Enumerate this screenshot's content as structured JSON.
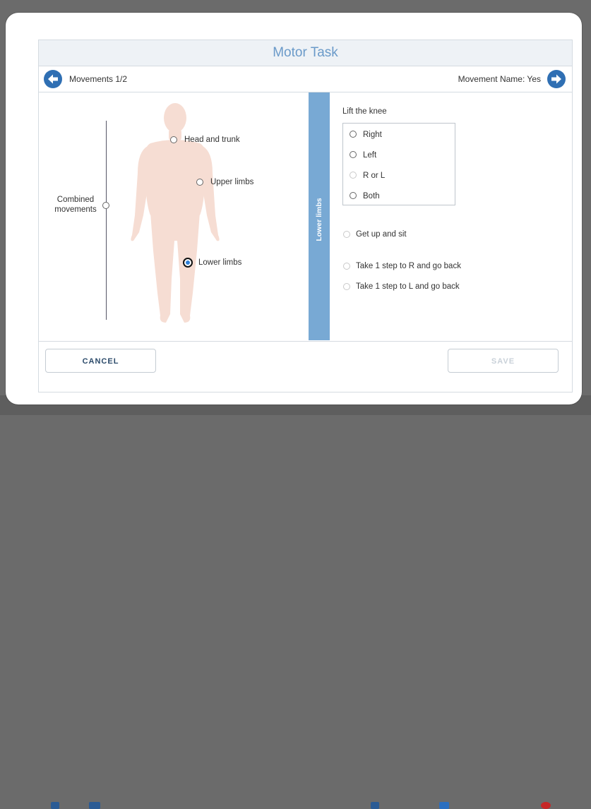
{
  "modal": {
    "title": "Motor Task"
  },
  "nav": {
    "left_label": "Movements 1/2",
    "right_label": "Movement Name: Yes",
    "back_icon": "arrow-left-icon",
    "forward_icon": "arrow-right-icon"
  },
  "body_map": {
    "combined_label": "Combined movements",
    "regions": [
      {
        "label": "Head and trunk",
        "selected": false
      },
      {
        "label": "Upper limbs",
        "selected": false
      },
      {
        "label": "Lower limbs",
        "selected": true
      }
    ]
  },
  "side_band": {
    "label": "Lower limbs"
  },
  "lift_knee": {
    "title": "Lift the knee",
    "options": [
      {
        "label": "Right",
        "enabled": true
      },
      {
        "label": "Left",
        "enabled": true
      },
      {
        "label": "R or L",
        "enabled": false
      },
      {
        "label": "Both",
        "enabled": true
      }
    ]
  },
  "other_options": [
    {
      "label": "Get up and sit",
      "enabled": false
    },
    {
      "label": "Take 1 step to R and go back",
      "enabled": false
    },
    {
      "label": "Take 1 step to L and go back",
      "enabled": false
    }
  ],
  "footer": {
    "cancel_label": "CANCEL",
    "save_label": "SAVE",
    "save_enabled": false
  },
  "colors": {
    "accent": "#2f6fb3",
    "title_text": "#6a9ac9",
    "band": "#78a9d4",
    "silhouette": "#f6ddd3",
    "selected_radio": "#2e7ed6"
  }
}
